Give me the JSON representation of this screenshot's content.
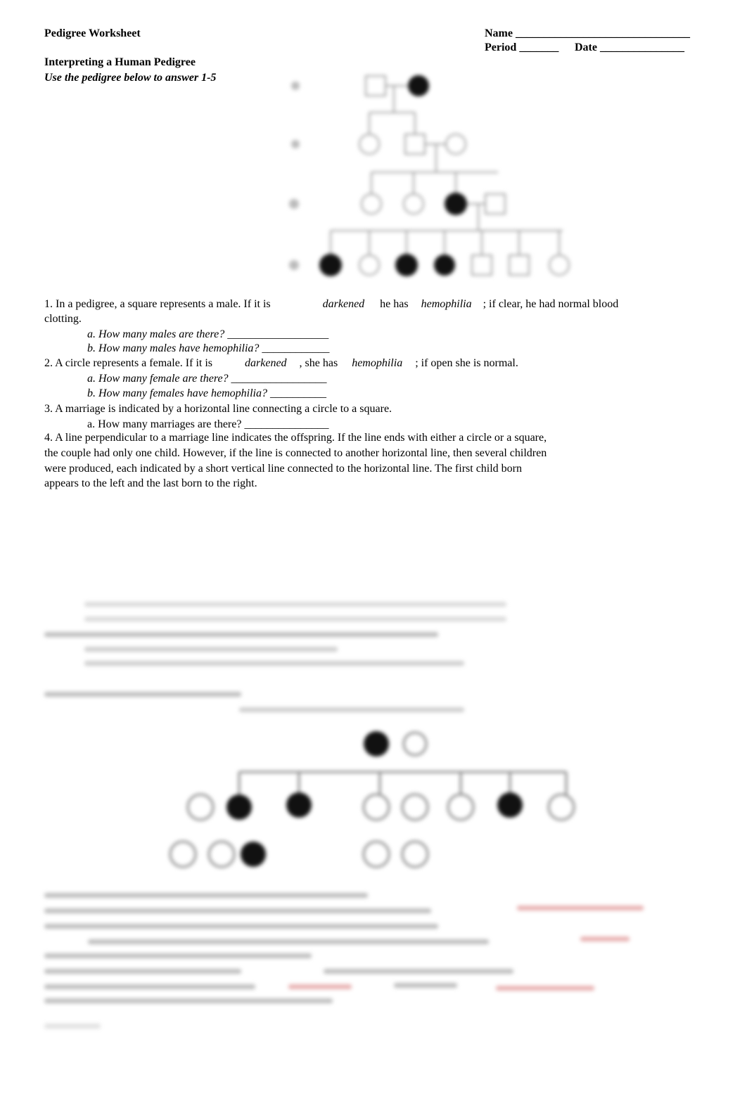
{
  "header": {
    "title": "Pedigree Worksheet",
    "name_label": "Name _______________________________",
    "period_label": "Period _______",
    "date_label": "Date _______________",
    "section_title": "Interpreting a Human Pedigree",
    "instruction": "Use the pedigree below to answer 1-5"
  },
  "questions": {
    "q1": {
      "pre": "1. In a pedigree, a square represents a male. If it is",
      "w1": "darkened",
      "mid": "he has",
      "w2": "hemophilia",
      "post": "; if clear, he had normal blood",
      "cont": "clotting.",
      "a": "a. How many males are there? __________________",
      "b": "b. How many males have hemophilia? ____________"
    },
    "q2": {
      "pre": "2. A circle represents a female. If it is",
      "w1": "darkened",
      "mid": ", she has",
      "w2": "hemophilia",
      "post": "; if open she is normal.",
      "a": "a. How many female are there? _________________",
      "b": "b. How many females have hemophilia? __________"
    },
    "q3": {
      "text": "3. A marriage is indicated by a horizontal line connecting a circle to a square.",
      "a": "a. How many marriages are there? _______________"
    },
    "q4": {
      "lines": [
        "4. A line perpendicular to a marriage line indicates the offspring. If the line ends with either a circle or a square,",
        "the couple had only one child. However, if the line is connected to another horizontal line, then several children",
        "were produced, each indicated by a short vertical line connected to the horizontal line. The first child born",
        "appears to the left and the last born to the right."
      ]
    }
  },
  "colors": {
    "text": "#000000",
    "answer": "#c0392b",
    "filled": "#111111"
  }
}
